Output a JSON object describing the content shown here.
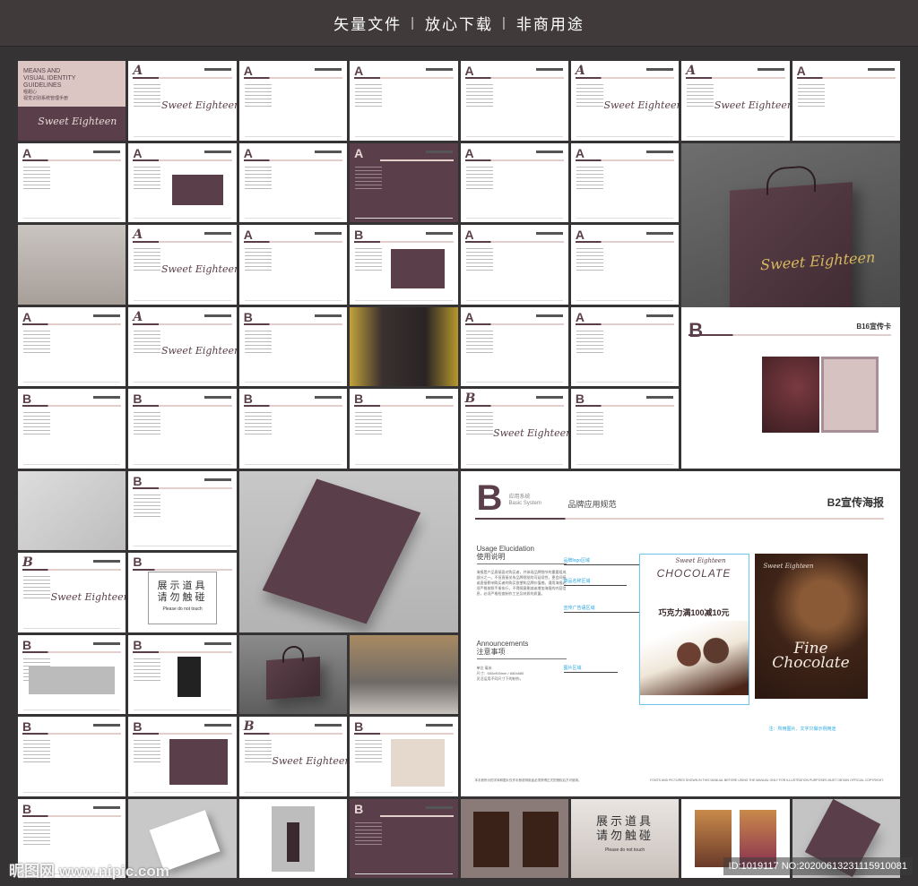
{
  "banner": {
    "items": [
      "矢量文件",
      "放心下载",
      "非商用途"
    ],
    "separator": "|"
  },
  "cover": {
    "title_lines": [
      "MEANS AND",
      "VISUAL IDENTITY",
      "GUIDELINES"
    ],
    "brand_cn": "喔甜心",
    "subtitle_cn": "视觉识别系统管理手册",
    "logo_text": "Sweet Eighteen"
  },
  "logo_text": "Sweet Eighteen",
  "letters": {
    "a": "A",
    "b": "B"
  },
  "b16": {
    "title": "B16宣传卡",
    "letter": "B"
  },
  "b2": {
    "letter": "B",
    "system_cn": "应用系统",
    "system_en": "Basic System",
    "section": "品牌应用规范",
    "title": "B2宣传海报",
    "usage_en": "Usage Elucidation",
    "usage_cn": "使用说明",
    "usage_text": "海报是产品直接面对购买者，并体现品牌细节的重要组成部分之一。不但直接关系品牌视觉的可延续性，更会间接或直接影响购买者的购买欲望和品牌价值感。通用海报必须严格按照手册执行，不得随意删减或增加海报的内容信息，必须严格检查制作工艺及材质的质量。",
    "ann_en": "Announcements",
    "ann_cn": "注意事项",
    "ann_text": [
      "单位 毫米",
      "尺寸：650x900mm / 680x880",
      "灵活运用不同尺寸下的制作。"
    ],
    "callouts": [
      "品牌logo区域",
      "菜品名称区域",
      "宣传广告语区域",
      "图片区域"
    ],
    "poster_heading": "CHOCOLATE",
    "poster_promo": "巧克力满100减10元",
    "poster2_text": "Fine Chocolate",
    "note": "注：所用图片、文字只做示例用途",
    "disclaimer_cn": "本手册所示的字体和图片仅作手册说明用途必须获得正式的授权后方可使用。",
    "disclaimer_en": "FONTS AND PICTURES SHOWN IN THIS MANUAL BEFORE USING THE MANUAL ONLY FOR ILLUSTRATION PURPOSES MUST OBTAIN OFFICIAL COPYRIGHT."
  },
  "sign": {
    "line1": "展示道具",
    "line2": "请勿触碰",
    "en": "Please do not touch"
  },
  "watermark": {
    "site": "昵图网 www.nipic.com",
    "id": "ID:1019117 NO:20200613231115910081"
  }
}
